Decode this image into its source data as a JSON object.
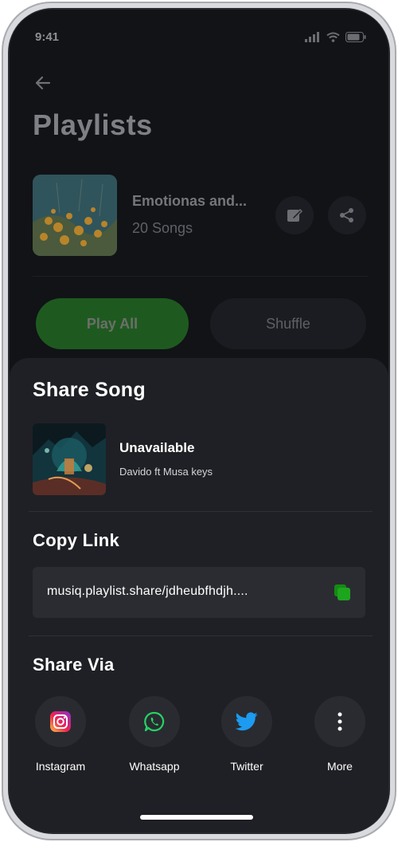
{
  "status_bar": {
    "time": "9:41"
  },
  "page": {
    "title": "Playlists",
    "playlist": {
      "name": "Emotionas and...",
      "count": "20 Songs"
    },
    "play_all_label": "Play All",
    "shuffle_label": "Shuffle"
  },
  "sheet": {
    "title": "Share Song",
    "song": {
      "title": "Unavailable",
      "artist": "Davido ft Musa keys"
    },
    "copy_link_title": "Copy Link",
    "link_value": "musiq.playlist.share/jdheubfhdjh....",
    "share_via_title": "Share Via",
    "share_targets": [
      {
        "label": "Instagram",
        "icon": "instagram-icon"
      },
      {
        "label": "Whatsapp",
        "icon": "whatsapp-icon"
      },
      {
        "label": "Twitter",
        "icon": "twitter-icon"
      },
      {
        "label": "More",
        "icon": "more-vertical-icon"
      }
    ]
  },
  "colors": {
    "accent_green": "#1ea51e",
    "sheet_bg": "#1f2025",
    "twitter_blue": "#1d9bf0",
    "whatsapp_green": "#25d366"
  }
}
